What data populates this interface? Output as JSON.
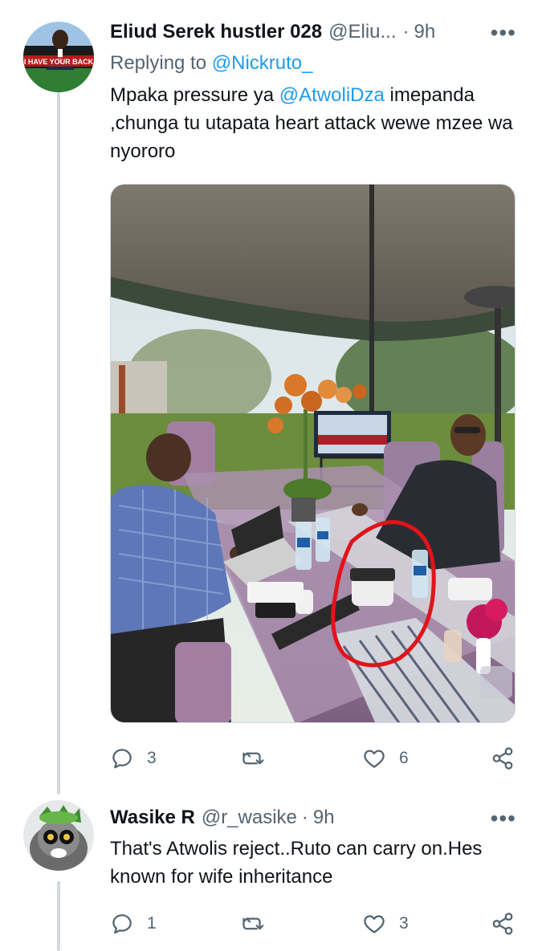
{
  "tweet1": {
    "display_name": "Eliud Serek hustler 028",
    "handle": "@Eliu...",
    "separator": "·",
    "time": "9h",
    "more": "•••",
    "replying_prefix": "Replying to",
    "replying_handle": "@Nickruto_",
    "text_part1": "Mpaka pressure ya",
    "text_mention": "@AtwoliDza",
    "text_part2": "imepanda ,chunga tu utapata heart attack wewe mzee wa nyororo",
    "avatar_banner": "I HAVE YOUR BACK",
    "replies": "3",
    "retweets": "",
    "likes": "6"
  },
  "tweet2": {
    "display_name": "Wasike R",
    "handle": "@r_wasike",
    "separator": "·",
    "time": "9h",
    "more": "•••",
    "text": "That's Atwolis reject..Ruto can carry on.Hes known for wife inheritance",
    "replies": "1",
    "retweets": "",
    "likes": "3"
  },
  "colors": {
    "thread_line": "#cfd9de",
    "muted": "#536471",
    "link": "#1d9bf0",
    "annotation_red": "#e0141a"
  },
  "icons": [
    "reply-icon",
    "retweet-icon",
    "like-icon",
    "share-icon",
    "more-icon"
  ]
}
